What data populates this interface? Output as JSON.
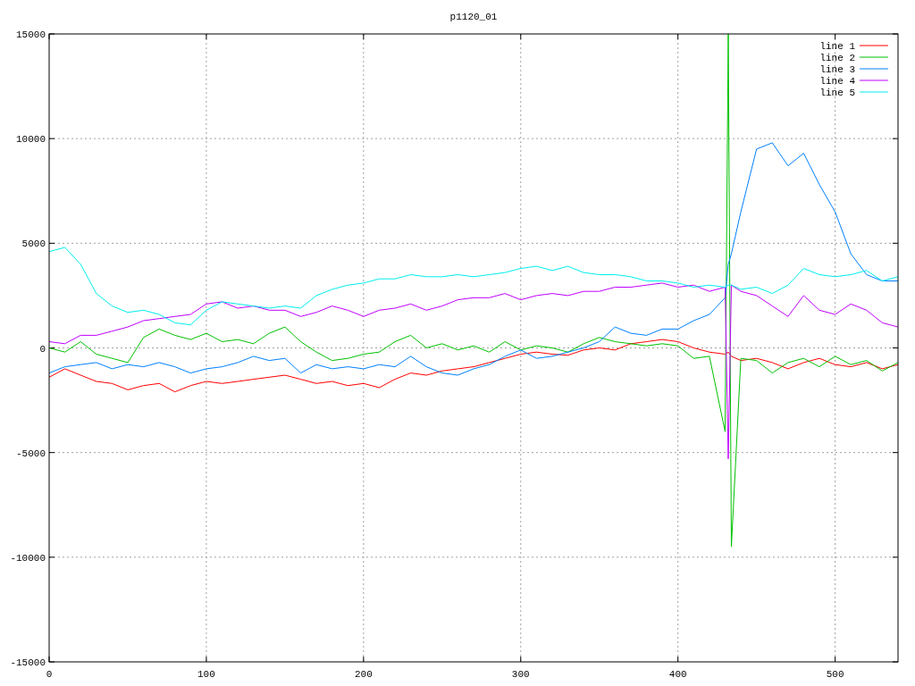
{
  "chart_data": {
    "type": "line",
    "title": "p1120_01",
    "grid": true,
    "legend": true,
    "xlim": [
      0,
      540
    ],
    "ylim": [
      -15000,
      15000
    ],
    "xticks": [
      0,
      100,
      200,
      300,
      400,
      500
    ],
    "yticks": [
      -15000,
      -10000,
      -5000,
      0,
      5000,
      10000,
      15000
    ],
    "x": [
      0,
      10,
      20,
      30,
      40,
      50,
      60,
      70,
      80,
      90,
      100,
      110,
      120,
      130,
      140,
      150,
      160,
      170,
      180,
      190,
      200,
      210,
      220,
      230,
      240,
      250,
      260,
      270,
      280,
      290,
      300,
      310,
      320,
      330,
      340,
      350,
      360,
      370,
      380,
      390,
      400,
      410,
      420,
      430,
      432,
      434,
      440,
      450,
      460,
      470,
      480,
      490,
      500,
      510,
      520,
      530,
      540
    ],
    "series": [
      {
        "name": "line 1",
        "color": "#ff0000",
        "values": [
          -1400,
          -1000,
          -1300,
          -1600,
          -1700,
          -2000,
          -1800,
          -1700,
          -2100,
          -1800,
          -1600,
          -1700,
          -1600,
          -1500,
          -1400,
          -1300,
          -1500,
          -1700,
          -1600,
          -1800,
          -1700,
          -1900,
          -1500,
          -1200,
          -1300,
          -1100,
          -1000,
          -900,
          -700,
          -500,
          -300,
          -200,
          -300,
          -350,
          -100,
          0,
          -100,
          200,
          300,
          400,
          300,
          0,
          -200,
          -300,
          -200,
          -400,
          -600,
          -500,
          -700,
          -1000,
          -700,
          -500,
          -800,
          -900,
          -700,
          -1000,
          -800
        ]
      },
      {
        "name": "line 2",
        "color": "#00c000",
        "values": [
          0,
          -200,
          300,
          -300,
          -500,
          -700,
          500,
          900,
          600,
          400,
          700,
          300,
          400,
          200,
          700,
          1000,
          300,
          -200,
          -600,
          -500,
          -300,
          -200,
          300,
          600,
          0,
          200,
          -100,
          100,
          -200,
          300,
          -100,
          100,
          0,
          -200,
          200,
          500,
          300,
          200,
          100,
          200,
          100,
          -500,
          -400,
          -4000,
          15000,
          -9500,
          -500,
          -600,
          -1200,
          -700,
          -500,
          -900,
          -400,
          -800,
          -600,
          -1100,
          -700
        ]
      },
      {
        "name": "line 3",
        "color": "#0080ff",
        "values": [
          -1200,
          -900,
          -800,
          -700,
          -1000,
          -800,
          -900,
          -700,
          -900,
          -1200,
          -1000,
          -900,
          -700,
          -400,
          -600,
          -500,
          -1200,
          -800,
          -1000,
          -900,
          -1000,
          -800,
          -900,
          -400,
          -900,
          -1200,
          -1300,
          -1000,
          -800,
          -400,
          -100,
          -500,
          -400,
          -200,
          0,
          300,
          1000,
          700,
          600,
          900,
          900,
          1300,
          1600,
          2400,
          4000,
          4500,
          6500,
          9500,
          9800,
          8700,
          9300,
          7800,
          6500,
          4500,
          3500,
          3200,
          3200
        ]
      },
      {
        "name": "line 4",
        "color": "#c000ff",
        "values": [
          300,
          200,
          600,
          600,
          800,
          1000,
          1300,
          1400,
          1500,
          1600,
          2100,
          2200,
          1900,
          2000,
          1800,
          1800,
          1500,
          1700,
          2000,
          1800,
          1500,
          1800,
          1900,
          2100,
          1800,
          2000,
          2300,
          2400,
          2400,
          2600,
          2300,
          2500,
          2600,
          2500,
          2700,
          2700,
          2900,
          2900,
          3000,
          3100,
          2900,
          3000,
          2700,
          2900,
          -5300,
          3000,
          2700,
          2500,
          2000,
          1500,
          2500,
          1800,
          1600,
          2100,
          1800,
          1200,
          1000
        ]
      },
      {
        "name": "line 5",
        "color": "#00eeee",
        "values": [
          4600,
          4800,
          4000,
          2600,
          2000,
          1700,
          1800,
          1600,
          1200,
          1100,
          1800,
          2200,
          2100,
          2000,
          1900,
          2000,
          1900,
          2500,
          2800,
          3000,
          3100,
          3300,
          3300,
          3500,
          3400,
          3400,
          3500,
          3400,
          3500,
          3600,
          3800,
          3900,
          3700,
          3900,
          3600,
          3500,
          3500,
          3400,
          3200,
          3200,
          3100,
          2900,
          3000,
          2900,
          3000,
          3000,
          2800,
          2900,
          2600,
          3000,
          3800,
          3500,
          3400,
          3500,
          3700,
          3200,
          3400
        ]
      }
    ]
  }
}
